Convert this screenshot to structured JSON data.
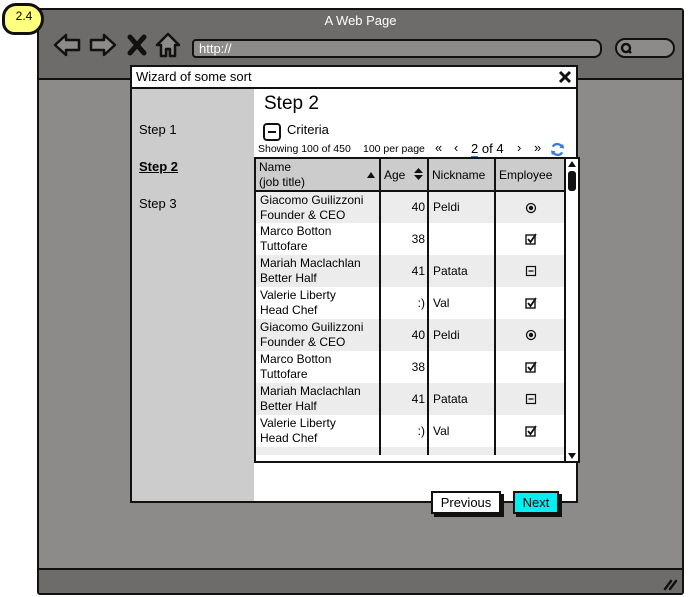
{
  "annotation_badge": "2.4",
  "browser": {
    "title": "A Web Page",
    "url": "http://",
    "icons": [
      "back-icon",
      "forward-icon",
      "stop-icon",
      "home-icon",
      "search-icon",
      "resize-icon"
    ]
  },
  "dialog": {
    "title": "Wizard of some sort",
    "steps": [
      {
        "label": "Step 1",
        "active": false
      },
      {
        "label": "Step 2",
        "active": true
      },
      {
        "label": "Step 3",
        "active": false
      }
    ],
    "step_title": "Step 2",
    "criteria_label": "Criteria",
    "pager": {
      "showing": "Showing 100 of 450",
      "per_page": "100 per page",
      "first": "«",
      "prev": "‹",
      "current_page": "2",
      "of_total": "of 4",
      "next": "›",
      "last": "»"
    },
    "grid": {
      "columns": [
        {
          "label_line1": "Name",
          "label_line2": "(job title)",
          "sort": "ascending"
        },
        {
          "label": "Age",
          "sort": "both"
        },
        {
          "label": "Nickname"
        },
        {
          "label": "Employee",
          "sort": "dropdown"
        }
      ],
      "rows": [
        {
          "name": "Giacomo Guilizzoni",
          "title": "Founder & CEO",
          "age": "40",
          "nickname": "Peldi",
          "employee": "radio-selected"
        },
        {
          "name": "Marco Botton",
          "title": "Tuttofare",
          "age": "38",
          "nickname": "",
          "employee": "checked"
        },
        {
          "name": "Mariah Maclachlan",
          "title": "Better Half",
          "age": "41",
          "nickname": "Patata",
          "employee": "indeterminate"
        },
        {
          "name": "Valerie Liberty",
          "title": "Head Chef",
          "age": ":)",
          "nickname": "Val",
          "employee": "checked"
        },
        {
          "name": "Giacomo Guilizzoni",
          "title": "Founder & CEO",
          "age": "40",
          "nickname": "Peldi",
          "employee": "radio-selected"
        },
        {
          "name": "Marco Botton",
          "title": "Tuttofare",
          "age": "38",
          "nickname": "",
          "employee": "checked"
        },
        {
          "name": "Mariah Maclachlan",
          "title": "Better Half",
          "age": "41",
          "nickname": "Patata",
          "employee": "indeterminate"
        },
        {
          "name": "Valerie Liberty",
          "title": "Head Chef",
          "age": ":)",
          "nickname": "Val",
          "employee": "checked"
        }
      ]
    },
    "buttons": {
      "previous": "Previous",
      "next": "Next"
    },
    "colors": {
      "next_button": "#00f0f0",
      "sidebar": "#cccccc",
      "header": "#cccccc",
      "alt_row": "#ececec",
      "refresh_icon": "#3a7bd5",
      "badge": "#ffff80"
    }
  }
}
